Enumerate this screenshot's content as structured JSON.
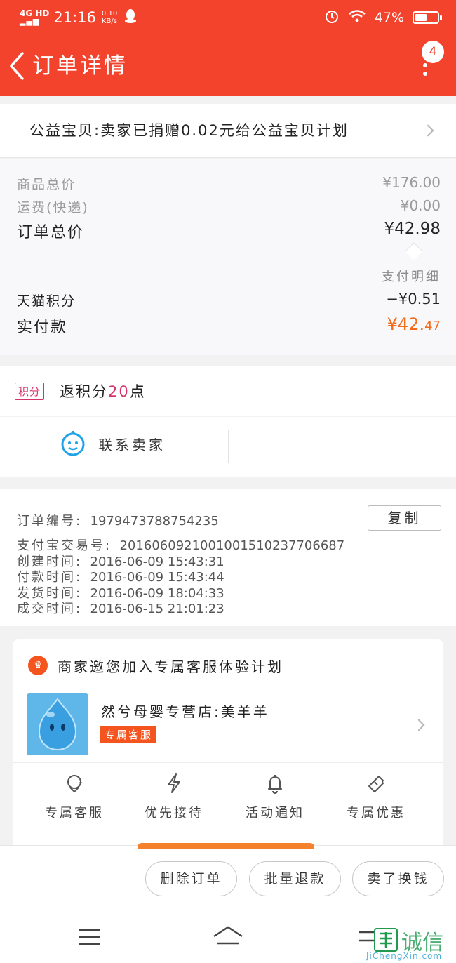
{
  "status_bar": {
    "network": "4G HD",
    "time": "21:16",
    "speed_value": "0.10",
    "speed_unit": "KB/s",
    "battery": "47%"
  },
  "header": {
    "title": "订单详情",
    "badge_count": "4"
  },
  "charity": {
    "text": "公益宝贝:卖家已捐赠0.02元给公益宝贝计划"
  },
  "price": {
    "goods_total_label": "商品总价",
    "goods_total_value": "¥176.00",
    "shipping_label": "运费(快递)",
    "shipping_value": "¥0.00",
    "order_total_label": "订单总价",
    "order_total_value": "¥42.98",
    "pay_detail_label": "支付明细",
    "tmall_points_label": "天猫积分",
    "tmall_points_value": "−¥0.51",
    "paid_label": "实付款",
    "paid_value_main": "¥42.",
    "paid_value_cents": "47"
  },
  "points": {
    "tag": "积分",
    "prefix": "返积分",
    "amount": "20",
    "suffix": "点"
  },
  "contact": {
    "label": "联系卖家"
  },
  "order_info": {
    "order_no_label": "订单编号:",
    "order_no": "1979473788754235",
    "copy_label": "复制",
    "alipay_label": "支付宝交易号:",
    "alipay_no": "2016060921001001510237706687",
    "created_label": "创建时间:",
    "created": "2016-06-09 15:43:31",
    "paid_label": "付款时间:",
    "paid": "2016-06-09 15:43:44",
    "shipped_label": "发货时间:",
    "shipped": "2016-06-09 18:04:33",
    "completed_label": "成交时间:",
    "completed": "2016-06-15 21:01:23"
  },
  "vip": {
    "title": "商家邀您加入专属客服体验计划",
    "shop_name": "然兮母婴专营店:美羊羊",
    "tag": "专属客服",
    "features": [
      {
        "label": "专属客服",
        "icon": "headset-icon"
      },
      {
        "label": "优先接待",
        "icon": "lightning-icon"
      },
      {
        "label": "活动通知",
        "icon": "bell-icon"
      },
      {
        "label": "专属优惠",
        "icon": "ticket-icon"
      }
    ]
  },
  "actions": {
    "delete": "删除订单",
    "batch_refund": "批量退款",
    "resell": "卖了换钱"
  },
  "watermark": {
    "text": "诚信",
    "sub": "JiChengXin.com"
  },
  "colors": {
    "brand": "#f4432d",
    "accent_orange": "#f46a1b",
    "points_pink": "#d6336c"
  }
}
